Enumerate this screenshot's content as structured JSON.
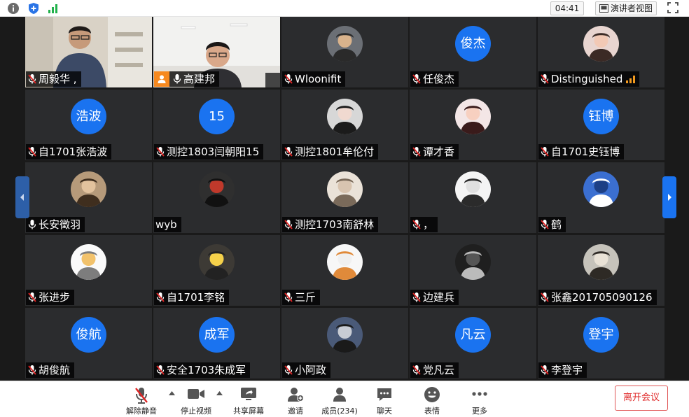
{
  "topbar": {
    "timer": "04:41",
    "view_label": "演讲者视图"
  },
  "participants": [
    {
      "name": "周毅华 ,",
      "type": "video",
      "mic": "muted"
    },
    {
      "name": "高建邦",
      "type": "video",
      "mic": "on",
      "host": true
    },
    {
      "name": "Wloonifit",
      "type": "photo",
      "mic": "muted"
    },
    {
      "name": "任俊杰",
      "type": "text",
      "avatar_text": "俊杰",
      "mic": "muted"
    },
    {
      "name": "Distinguished",
      "type": "photo",
      "mic": "muted",
      "signal": true
    },
    {
      "name": "自1701张浩波",
      "type": "text",
      "avatar_text": "浩波",
      "mic": "muted"
    },
    {
      "name": "测控1803闫朝阳15",
      "type": "text",
      "avatar_text": "15",
      "mic": "muted"
    },
    {
      "name": "测控1801牟伦付",
      "type": "photo",
      "mic": "muted"
    },
    {
      "name": "谭才香",
      "type": "photo",
      "mic": "muted"
    },
    {
      "name": "自1701史钰博",
      "type": "text",
      "avatar_text": "钰博",
      "mic": "muted"
    },
    {
      "name": "长安徵羽",
      "type": "photo",
      "mic": "on"
    },
    {
      "name": "wyb",
      "type": "photo",
      "mic": "none"
    },
    {
      "name": "测控1703南舒林",
      "type": "photo",
      "mic": "muted"
    },
    {
      "name": "，",
      "type": "photo",
      "mic": "muted"
    },
    {
      "name": "鹤",
      "type": "photo",
      "mic": "muted"
    },
    {
      "name": "张进步",
      "type": "photo",
      "mic": "muted"
    },
    {
      "name": "自1701李铭",
      "type": "photo",
      "mic": "muted"
    },
    {
      "name": "三斤",
      "type": "photo",
      "mic": "muted"
    },
    {
      "name": "边建兵",
      "type": "photo",
      "mic": "muted"
    },
    {
      "name": "张鑫201705090126",
      "type": "photo",
      "mic": "muted"
    },
    {
      "name": "胡俊航",
      "type": "text",
      "avatar_text": "俊航",
      "mic": "muted"
    },
    {
      "name": "安全1703朱成军",
      "type": "text",
      "avatar_text": "成军",
      "mic": "muted"
    },
    {
      "name": "小阿政",
      "type": "photo",
      "mic": "muted"
    },
    {
      "name": "党凡云",
      "type": "text",
      "avatar_text": "凡云",
      "mic": "muted"
    },
    {
      "name": "李登宇",
      "type": "text",
      "avatar_text": "登宇",
      "mic": "muted"
    }
  ],
  "toolbar": {
    "unmute": "解除静音",
    "stop_video": "停止视频",
    "share": "共享屏幕",
    "invite": "邀请",
    "members": "成员(234)",
    "chat": "聊天",
    "reactions": "表情",
    "more": "更多",
    "leave": "离开会议"
  },
  "colors": {
    "accent": "#1a73f0",
    "tile_bg": "#2b2c2e",
    "stage_bg": "#1a1a1a",
    "mute_red": "#e02424",
    "leave_red": "#e02a2a",
    "host_orange": "#f6891f"
  }
}
